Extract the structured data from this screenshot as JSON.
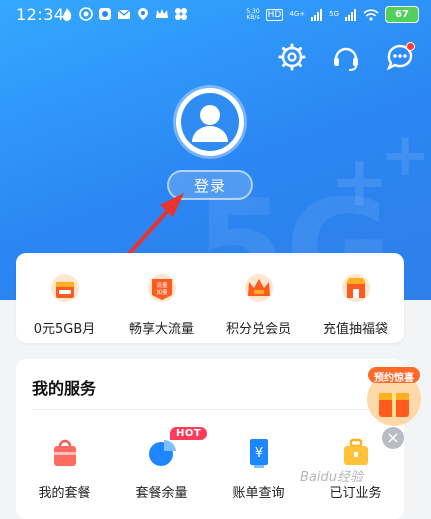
{
  "status_bar": {
    "time": "12:34",
    "net_speed": "5.30\nKB/s",
    "hd_label": "HD",
    "sig1": "4G+",
    "sig2": "5G",
    "battery": "67"
  },
  "header": {
    "login_label": "登录"
  },
  "quick_actions": [
    {
      "label": "0元5GB月",
      "icon": "gift-icon"
    },
    {
      "label": "畅享大流量",
      "icon": "traffic-badge-icon",
      "icon_text": "流量\n加量"
    },
    {
      "label": "积分兑会员",
      "icon": "crown-icon"
    },
    {
      "label": "充值抽福袋",
      "icon": "shop-icon"
    }
  ],
  "services": {
    "title": "我的服务",
    "items": [
      {
        "label": "我的套餐",
        "icon": "bag-icon"
      },
      {
        "label": "套餐余量",
        "icon": "pie-chart-icon"
      },
      {
        "label": "账单查询",
        "icon": "bill-icon"
      },
      {
        "label": "已订业务",
        "icon": "briefcase-icon"
      }
    ],
    "hot_badge": "HOT"
  },
  "promo": {
    "title": "预约惊喜"
  },
  "watermark": "Baidu经验",
  "colors": {
    "primary": "#2b86f3",
    "accent": "#ff5a1f",
    "hot": "#ff3b5c"
  }
}
